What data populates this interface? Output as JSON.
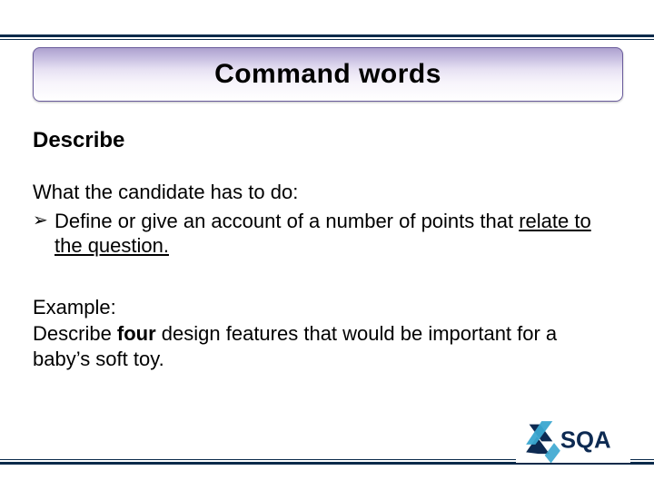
{
  "title": "Command words",
  "section_heading": "Describe",
  "lead_in": "What the candidate has to do:",
  "bullet": {
    "marker": "➢",
    "text_part1": "Define or give an account of a number of points that ",
    "text_underlined": "relate to the question.",
    "text_part2": ""
  },
  "example": {
    "label": "Example:",
    "prefix": "Describe ",
    "bold_word": "four",
    "suffix": " design features that would be important for a baby’s soft toy."
  },
  "logo": {
    "text": "SQA",
    "colors": {
      "navy": "#0d2a52",
      "cyan": "#3aa6d0"
    }
  }
}
